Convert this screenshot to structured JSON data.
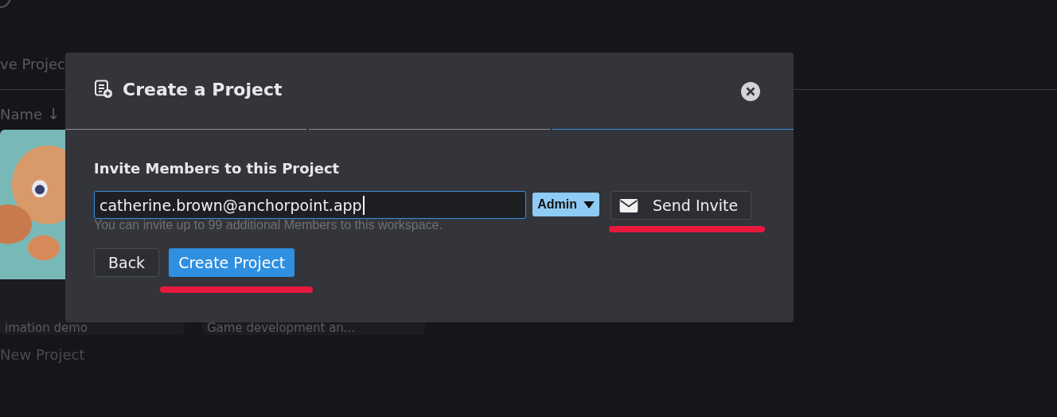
{
  "background": {
    "tab_label": "ve Projec",
    "sort_label": "Name",
    "sort_arrow": "↓",
    "cards": [
      {
        "title": "imation demo"
      },
      {
        "title": "Game development an..."
      }
    ],
    "new_project": "New Project"
  },
  "dialog": {
    "title": "Create a Project",
    "steps": [
      {
        "selected": false
      },
      {
        "selected": false
      },
      {
        "selected": true
      }
    ],
    "heading": "Invite Members to this Project",
    "email": {
      "value": "catherine.brown@anchorpoint.app",
      "focused": true
    },
    "role": "Admin",
    "send_button": "Send Invite",
    "hint": "You can invite up to 99 additional Members to this workspace.",
    "send_highlighted": true,
    "buttons": [
      {
        "label": "Back",
        "kind": "secondary",
        "highlighted": false
      },
      {
        "label": "Create Project",
        "kind": "primary",
        "highlighted": true
      }
    ]
  }
}
